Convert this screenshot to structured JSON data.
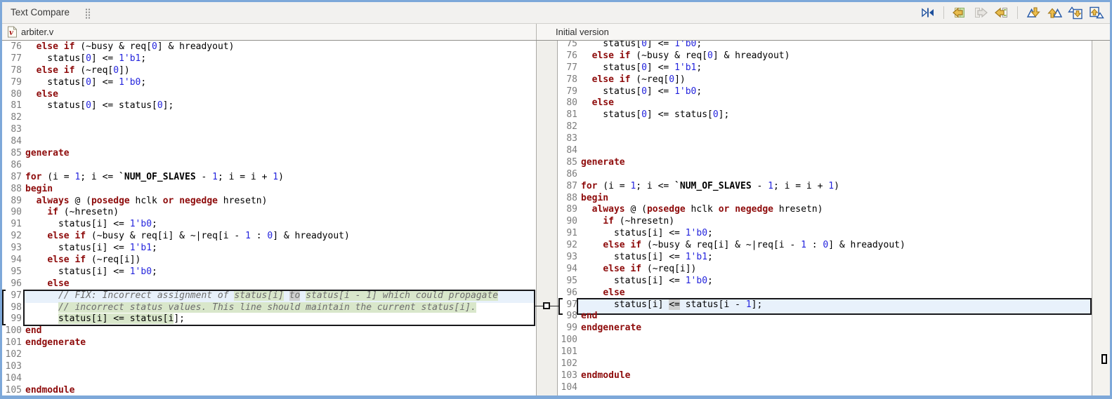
{
  "titlebar": {
    "title": "Text Compare"
  },
  "toolbar": {
    "icons": [
      {
        "name": "swap-left-and-right-icon",
        "disabled": false
      },
      {
        "name": "copy-all-from-right-to-left-icon",
        "disabled": false
      },
      {
        "name": "copy-current-change-from-left-to-right-icon",
        "disabled": true
      },
      {
        "name": "copy-current-change-from-right-to-left-icon",
        "disabled": false
      },
      {
        "name": "next-difference-icon",
        "disabled": false
      },
      {
        "name": "previous-difference-icon",
        "disabled": false
      },
      {
        "name": "next-change-icon",
        "disabled": false
      },
      {
        "name": "previous-change-icon",
        "disabled": false
      }
    ]
  },
  "headers": {
    "left_label": "arbiter.v",
    "right_label": "Initial version"
  },
  "colors": {
    "window_border": "#7da8d9",
    "keyword": "#8e0b0b",
    "number": "#2424dd",
    "comment": "#6d6d6d",
    "line_number": "#7c7c7c",
    "diff_added_bg": "#d9e7cb",
    "diff_word_bg": "#cfcfcf",
    "diff_current_line_bg": "#e8f1fb"
  },
  "panes": {
    "left": {
      "lines": [
        {
          "n": "76",
          "seg": [
            [
              "p",
              "  "
            ],
            [
              "k",
              "else if"
            ],
            [
              "p",
              " (~busy & req["
            ],
            [
              "n",
              "0"
            ],
            [
              "p",
              "] & hreadyout)"
            ]
          ]
        },
        {
          "n": "77",
          "seg": [
            [
              "p",
              "    status["
            ],
            [
              "n",
              "0"
            ],
            [
              "p",
              "] <= "
            ],
            [
              "n",
              "1'b1"
            ],
            [
              "p",
              ";"
            ]
          ]
        },
        {
          "n": "78",
          "seg": [
            [
              "p",
              "  "
            ],
            [
              "k",
              "else if"
            ],
            [
              "p",
              " (~req["
            ],
            [
              "n",
              "0"
            ],
            [
              "p",
              "])"
            ]
          ]
        },
        {
          "n": "79",
          "seg": [
            [
              "p",
              "    status["
            ],
            [
              "n",
              "0"
            ],
            [
              "p",
              "] <= "
            ],
            [
              "n",
              "1'b0"
            ],
            [
              "p",
              ";"
            ]
          ]
        },
        {
          "n": "80",
          "seg": [
            [
              "p",
              "  "
            ],
            [
              "k",
              "else"
            ]
          ]
        },
        {
          "n": "81",
          "seg": [
            [
              "p",
              "    status["
            ],
            [
              "n",
              "0"
            ],
            [
              "p",
              "] <= status["
            ],
            [
              "n",
              "0"
            ],
            [
              "p",
              "];"
            ]
          ]
        },
        {
          "n": "82",
          "seg": []
        },
        {
          "n": "83",
          "seg": []
        },
        {
          "n": "84",
          "seg": []
        },
        {
          "n": "85",
          "seg": [
            [
              "k",
              "generate"
            ]
          ]
        },
        {
          "n": "86",
          "seg": []
        },
        {
          "n": "87",
          "seg": [
            [
              "k",
              "for"
            ],
            [
              "p",
              " (i = "
            ],
            [
              "n",
              "1"
            ],
            [
              "p",
              "; i <= "
            ],
            [
              "m",
              "`NUM_OF_SLAVES"
            ],
            [
              "p",
              " - "
            ],
            [
              "n",
              "1"
            ],
            [
              "p",
              "; i = i + "
            ],
            [
              "n",
              "1"
            ],
            [
              "p",
              ")"
            ]
          ]
        },
        {
          "n": "88",
          "seg": [
            [
              "k",
              "begin"
            ]
          ]
        },
        {
          "n": "89",
          "seg": [
            [
              "p",
              "  "
            ],
            [
              "k",
              "always"
            ],
            [
              "p",
              " @ ("
            ],
            [
              "k",
              "posedge"
            ],
            [
              "p",
              " hclk "
            ],
            [
              "k",
              "or"
            ],
            [
              "p",
              " "
            ],
            [
              "k",
              "negedge"
            ],
            [
              "p",
              " hresetn)"
            ]
          ]
        },
        {
          "n": "90",
          "seg": [
            [
              "p",
              "    "
            ],
            [
              "k",
              "if"
            ],
            [
              "p",
              " (~hresetn)"
            ]
          ]
        },
        {
          "n": "91",
          "seg": [
            [
              "p",
              "      status[i] <= "
            ],
            [
              "n",
              "1'b0"
            ],
            [
              "p",
              ";"
            ]
          ]
        },
        {
          "n": "92",
          "seg": [
            [
              "p",
              "    "
            ],
            [
              "k",
              "else if"
            ],
            [
              "p",
              " (~busy & req[i] & ~|req[i - "
            ],
            [
              "n",
              "1"
            ],
            [
              "p",
              " : "
            ],
            [
              "n",
              "0"
            ],
            [
              "p",
              "] & hreadyout)"
            ]
          ]
        },
        {
          "n": "93",
          "seg": [
            [
              "p",
              "      status[i] <= "
            ],
            [
              "n",
              "1'b1"
            ],
            [
              "p",
              ";"
            ]
          ]
        },
        {
          "n": "94",
          "seg": [
            [
              "p",
              "    "
            ],
            [
              "k",
              "else if"
            ],
            [
              "p",
              " (~req[i])"
            ]
          ]
        },
        {
          "n": "95",
          "seg": [
            [
              "p",
              "      status[i] <= "
            ],
            [
              "n",
              "1'b0"
            ],
            [
              "p",
              ";"
            ]
          ]
        },
        {
          "n": "96",
          "seg": [
            [
              "p",
              "    "
            ],
            [
              "k",
              "else"
            ]
          ]
        },
        {
          "n": "97",
          "seg": [
            [
              "c",
              "      // FIX: Incorrect assignment of "
            ],
            [
              "c",
              "status[i]",
              "ga"
            ],
            [
              "c",
              " "
            ],
            [
              "c",
              "to",
              "gy"
            ],
            [
              "c",
              " "
            ],
            [
              "c",
              "status[i - 1] which could propagate",
              "ga"
            ]
          ]
        },
        {
          "n": "98",
          "seg": [
            [
              "c",
              "      "
            ],
            [
              "c",
              "// incorrect status values. This line should maintain the current status[i].",
              "ga"
            ]
          ]
        },
        {
          "n": "99",
          "seg": [
            [
              "p",
              "      "
            ],
            [
              "p",
              "status[i] <= status[i",
              "ga"
            ],
            [
              "p",
              "];"
            ]
          ]
        },
        {
          "n": "100",
          "seg": [
            [
              "k",
              "end"
            ]
          ]
        },
        {
          "n": "101",
          "seg": [
            [
              "k",
              "endgenerate"
            ]
          ]
        },
        {
          "n": "102",
          "seg": []
        },
        {
          "n": "103",
          "seg": []
        },
        {
          "n": "104",
          "seg": []
        },
        {
          "n": "105",
          "seg": [
            [
              "k",
              "endmodule"
            ]
          ]
        }
      ]
    },
    "right": {
      "lines": [
        {
          "n": "75",
          "seg": [
            [
              "p",
              "    status["
            ],
            [
              "n",
              "0"
            ],
            [
              "p",
              "] <= "
            ],
            [
              "n",
              "1'b0"
            ],
            [
              "p",
              ";"
            ]
          ]
        },
        {
          "n": "76",
          "seg": [
            [
              "p",
              "  "
            ],
            [
              "k",
              "else if"
            ],
            [
              "p",
              " (~busy & req["
            ],
            [
              "n",
              "0"
            ],
            [
              "p",
              "] & hreadyout)"
            ]
          ]
        },
        {
          "n": "77",
          "seg": [
            [
              "p",
              "    status["
            ],
            [
              "n",
              "0"
            ],
            [
              "p",
              "] <= "
            ],
            [
              "n",
              "1'b1"
            ],
            [
              "p",
              ";"
            ]
          ]
        },
        {
          "n": "78",
          "seg": [
            [
              "p",
              "  "
            ],
            [
              "k",
              "else if"
            ],
            [
              "p",
              " (~req["
            ],
            [
              "n",
              "0"
            ],
            [
              "p",
              "])"
            ]
          ]
        },
        {
          "n": "79",
          "seg": [
            [
              "p",
              "    status["
            ],
            [
              "n",
              "0"
            ],
            [
              "p",
              "] <= "
            ],
            [
              "n",
              "1'b0"
            ],
            [
              "p",
              ";"
            ]
          ]
        },
        {
          "n": "80",
          "seg": [
            [
              "p",
              "  "
            ],
            [
              "k",
              "else"
            ]
          ]
        },
        {
          "n": "81",
          "seg": [
            [
              "p",
              "    status["
            ],
            [
              "n",
              "0"
            ],
            [
              "p",
              "] <= status["
            ],
            [
              "n",
              "0"
            ],
            [
              "p",
              "];"
            ]
          ]
        },
        {
          "n": "82",
          "seg": []
        },
        {
          "n": "83",
          "seg": []
        },
        {
          "n": "84",
          "seg": []
        },
        {
          "n": "85",
          "seg": [
            [
              "k",
              "generate"
            ]
          ]
        },
        {
          "n": "86",
          "seg": []
        },
        {
          "n": "87",
          "seg": [
            [
              "k",
              "for"
            ],
            [
              "p",
              " (i = "
            ],
            [
              "n",
              "1"
            ],
            [
              "p",
              "; i <= "
            ],
            [
              "m",
              "`NUM_OF_SLAVES"
            ],
            [
              "p",
              " - "
            ],
            [
              "n",
              "1"
            ],
            [
              "p",
              "; i = i + "
            ],
            [
              "n",
              "1"
            ],
            [
              "p",
              ")"
            ]
          ]
        },
        {
          "n": "88",
          "seg": [
            [
              "k",
              "begin"
            ]
          ]
        },
        {
          "n": "89",
          "seg": [
            [
              "p",
              "  "
            ],
            [
              "k",
              "always"
            ],
            [
              "p",
              " @ ("
            ],
            [
              "k",
              "posedge"
            ],
            [
              "p",
              " hclk "
            ],
            [
              "k",
              "or"
            ],
            [
              "p",
              " "
            ],
            [
              "k",
              "negedge"
            ],
            [
              "p",
              " hresetn)"
            ]
          ]
        },
        {
          "n": "90",
          "seg": [
            [
              "p",
              "    "
            ],
            [
              "k",
              "if"
            ],
            [
              "p",
              " (~hresetn)"
            ]
          ]
        },
        {
          "n": "91",
          "seg": [
            [
              "p",
              "      status[i] <= "
            ],
            [
              "n",
              "1'b0"
            ],
            [
              "p",
              ";"
            ]
          ]
        },
        {
          "n": "92",
          "seg": [
            [
              "p",
              "    "
            ],
            [
              "k",
              "else if"
            ],
            [
              "p",
              " (~busy & req[i] & ~|req[i - "
            ],
            [
              "n",
              "1"
            ],
            [
              "p",
              " : "
            ],
            [
              "n",
              "0"
            ],
            [
              "p",
              "] & hreadyout)"
            ]
          ]
        },
        {
          "n": "93",
          "seg": [
            [
              "p",
              "      status[i] <= "
            ],
            [
              "n",
              "1'b1"
            ],
            [
              "p",
              ";"
            ]
          ]
        },
        {
          "n": "94",
          "seg": [
            [
              "p",
              "    "
            ],
            [
              "k",
              "else if"
            ],
            [
              "p",
              " (~req[i])"
            ]
          ]
        },
        {
          "n": "95",
          "seg": [
            [
              "p",
              "      status[i] <= "
            ],
            [
              "n",
              "1'b0"
            ],
            [
              "p",
              ";"
            ]
          ]
        },
        {
          "n": "96",
          "seg": [
            [
              "p",
              "    "
            ],
            [
              "k",
              "else"
            ]
          ]
        },
        {
          "n": "97",
          "seg": [
            [
              "p",
              "      status[i] "
            ],
            [
              "p",
              "<=",
              "gy"
            ],
            [
              "p",
              " status[i - "
            ],
            [
              "n",
              "1"
            ],
            [
              "p",
              "];"
            ]
          ]
        },
        {
          "n": "98",
          "seg": [
            [
              "k",
              "end"
            ]
          ]
        },
        {
          "n": "99",
          "seg": [
            [
              "k",
              "endgenerate"
            ]
          ]
        },
        {
          "n": "100",
          "seg": []
        },
        {
          "n": "101",
          "seg": []
        },
        {
          "n": "102",
          "seg": []
        },
        {
          "n": "103",
          "seg": [
            [
              "k",
              "endmodule"
            ]
          ]
        },
        {
          "n": "104",
          "seg": []
        }
      ]
    }
  }
}
